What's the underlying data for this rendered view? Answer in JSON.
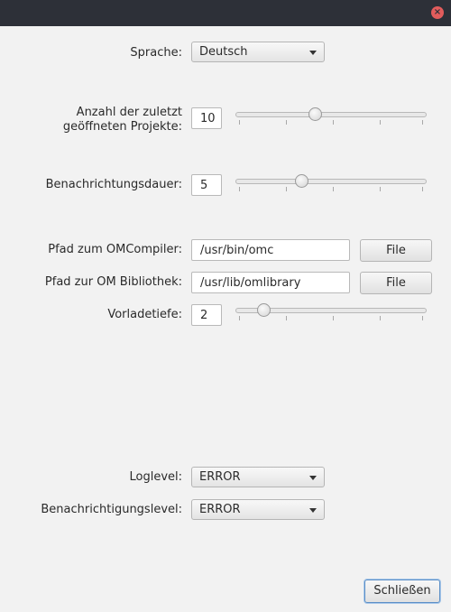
{
  "window": {
    "close_icon": "×"
  },
  "language": {
    "label": "Sprache:",
    "value": "Deutsch"
  },
  "recent_projects": {
    "label_line1": "Anzahl der zuletzt",
    "label_line2": "geöffneten Projekte:",
    "value": "10",
    "slider_fraction": 0.42
  },
  "notification_duration": {
    "label": "Benachrichtungsdauer:",
    "value": "5",
    "slider_fraction": 0.35
  },
  "compiler_path": {
    "label": "Pfad zum OMCompiler:",
    "value": "/usr/bin/omc",
    "button": "File"
  },
  "library_path": {
    "label": "Pfad zur OM Bibliothek:",
    "value": "/usr/lib/omlibrary",
    "button": "File"
  },
  "preload_depth": {
    "label": "Vorladetiefe:",
    "value": "2",
    "slider_fraction": 0.15
  },
  "loglevel": {
    "label": "Loglevel:",
    "value": "ERROR"
  },
  "notification_level": {
    "label": "Benachrichtigungslevel:",
    "value": "ERROR"
  },
  "close_button": "Schließen"
}
